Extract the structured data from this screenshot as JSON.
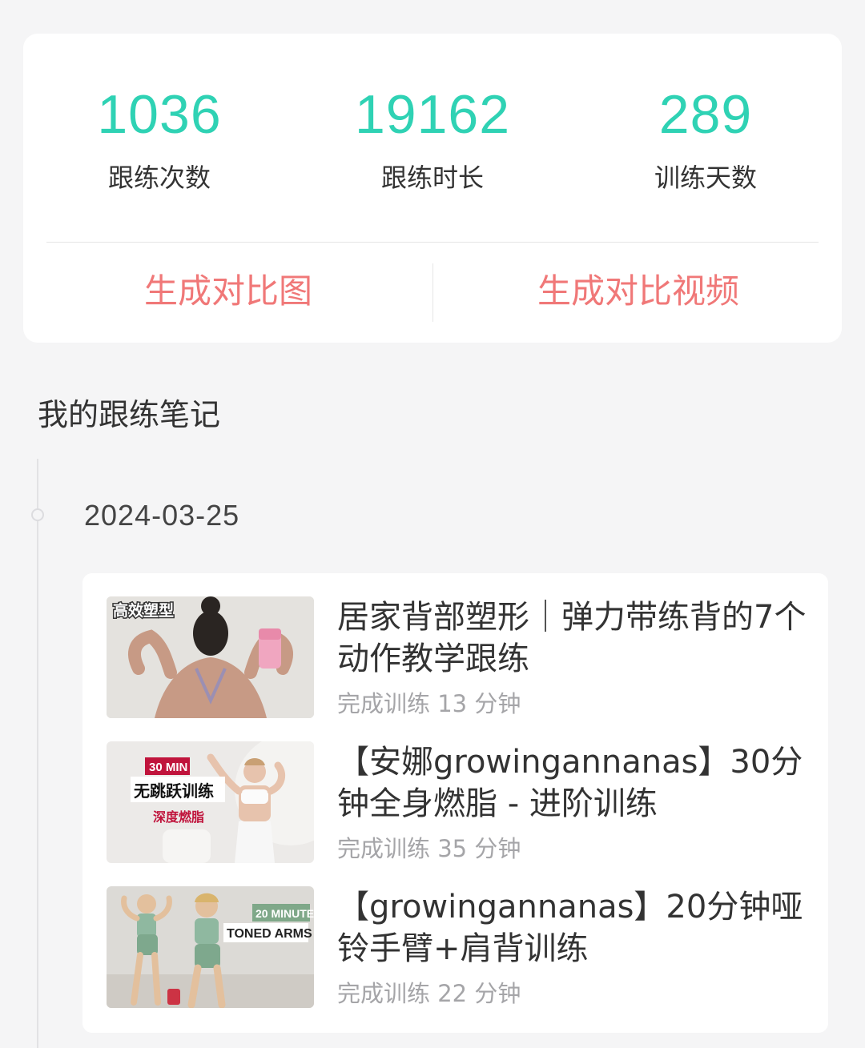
{
  "stats": [
    {
      "value": "1036",
      "label": "跟练次数"
    },
    {
      "value": "19162",
      "label": "跟练时长"
    },
    {
      "value": "289",
      "label": "训练天数"
    }
  ],
  "actions": {
    "compare_image": "生成对比图",
    "compare_video": "生成对比视频"
  },
  "section_title": "我的跟练笔记",
  "entry": {
    "date": "2024-03-25",
    "items": [
      {
        "title": "居家背部塑形｜弹力带练背的7个动作教学跟练",
        "subtitle": "完成训练 13 分钟",
        "thumb_text": [
          "高效塑型"
        ]
      },
      {
        "title": "【安娜growingannanas】30分钟全身燃脂 - 进阶训练",
        "subtitle": "完成训练 35 分钟",
        "thumb_text": [
          "30 MIN",
          "无跳跃训练",
          "深度燃脂"
        ]
      },
      {
        "title": "【growingannanas】20分钟哑铃手臂+肩背训练",
        "subtitle": "完成训练 22 分钟",
        "thumb_text": [
          "20 MINUTE",
          "TONED ARMS"
        ]
      }
    ]
  },
  "colors": {
    "accent_teal": "#2fd2b4",
    "action_red": "#f07878",
    "background": "#f5f5f6"
  }
}
